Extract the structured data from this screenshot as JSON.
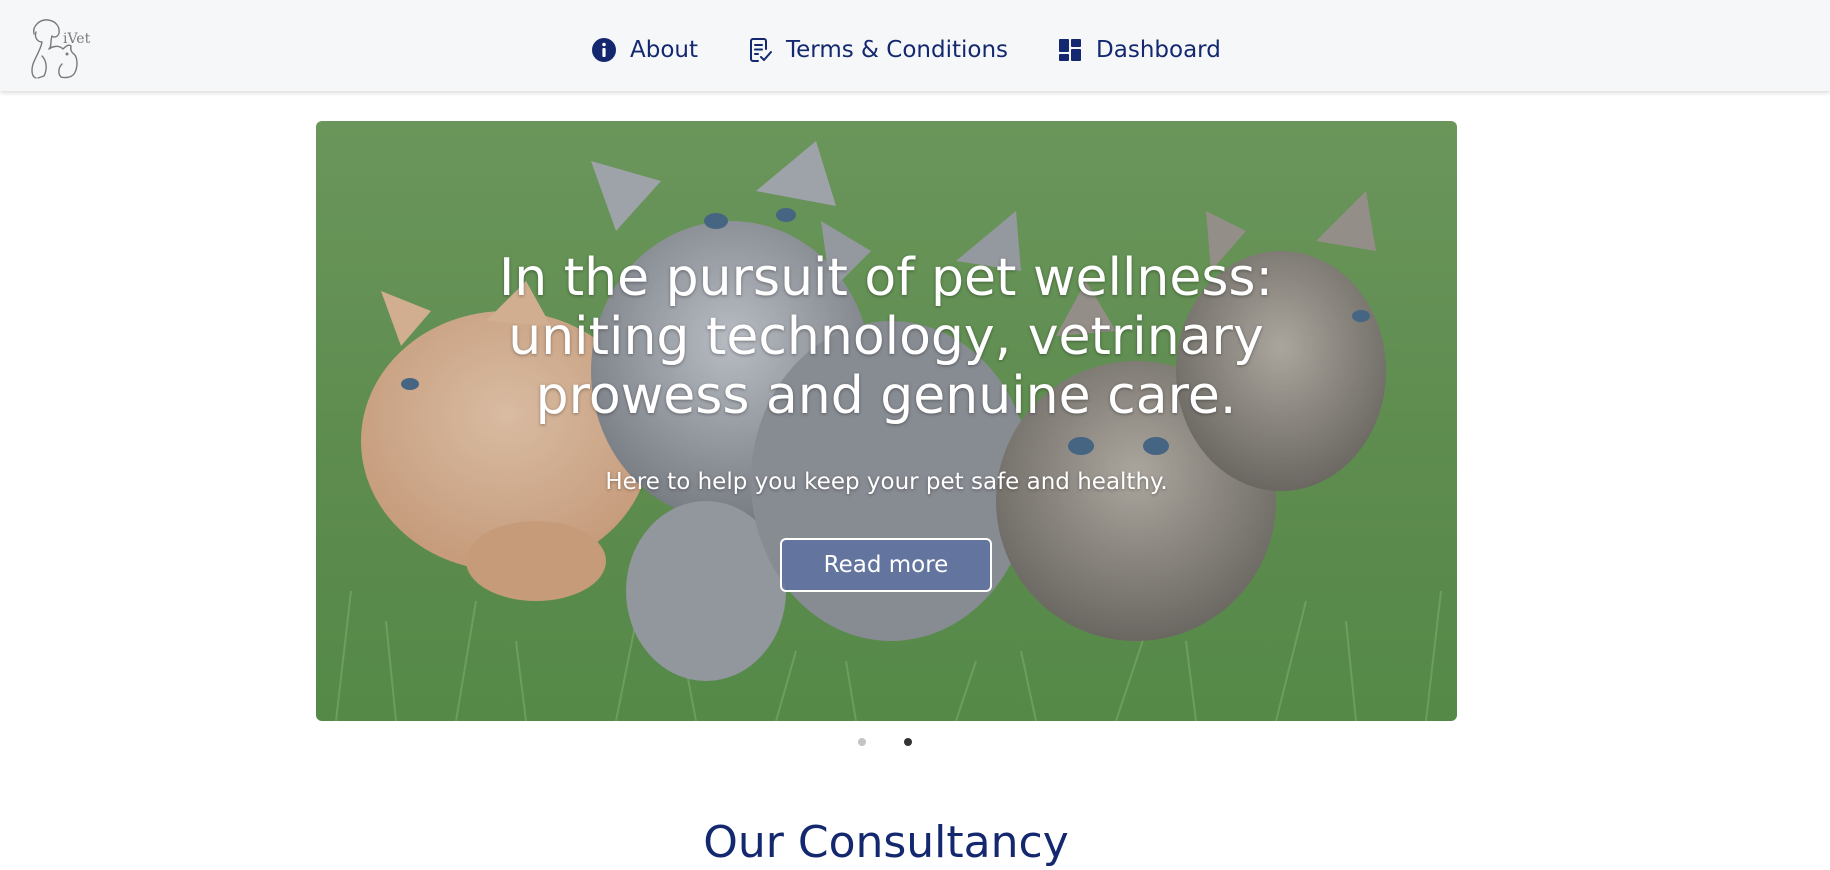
{
  "brand": {
    "logo_text": "iVet",
    "logo_icon": "dog-cat-icon"
  },
  "nav": {
    "items": [
      {
        "label": "About",
        "icon": "info-icon"
      },
      {
        "label": "Terms & Conditions",
        "icon": "document-check-icon"
      },
      {
        "label": "Dashboard",
        "icon": "dashboard-icon"
      }
    ]
  },
  "hero": {
    "title_lines": [
      "In the pursuit of pet wellness:",
      "uniting technology, vetrinary",
      "prowess and genuine care."
    ],
    "subtitle": "Here to help you keep your pet safe and healthy.",
    "button_label": "Read more",
    "slides_total": 2,
    "active_slide": 2
  },
  "section": {
    "title": "Our Consultancy"
  },
  "colors": {
    "primary_text": "#13286f",
    "navbar_bg": "#f6f7f9",
    "dot_active": "#333333",
    "dot_inactive": "#c4c4c4"
  }
}
